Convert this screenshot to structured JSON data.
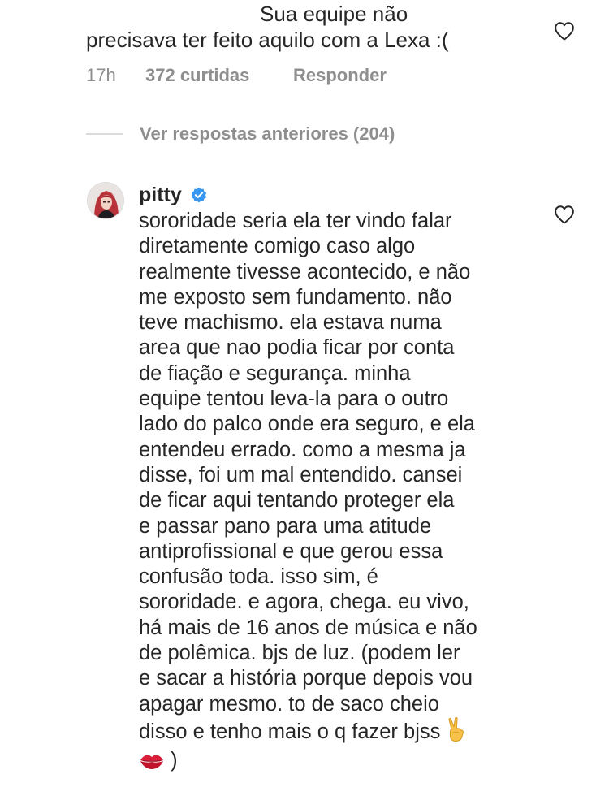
{
  "top_comment": {
    "text_lines": [
      "Sua equipe não",
      "precisava ter feito aquilo com a Lexa :("
    ],
    "time": "17h",
    "likes": "372 curtidas",
    "reply_label": "Responder"
  },
  "view_previous_replies": "Ver respostas anteriores (204)",
  "reply": {
    "username": "pitty",
    "verified": true,
    "text_lines": [
      "sororidade seria ela ter vindo falar",
      "diretamente comigo caso algo",
      "realmente tivesse acontecido, e não",
      "me exposto sem fundamento. não",
      "teve machismo. ela estava numa",
      "area que nao podia ficar por conta",
      "de fiação e segurança. minha",
      "equipe tentou leva-la para o outro",
      "lado do palco onde era seguro, e ela",
      "entendeu errado. como a mesma ja",
      "disse, foi um mal entendido. cansei",
      "de ficar aqui tentando proteger ela",
      "e passar pano para uma atitude",
      "antiprofissional e que gerou essa",
      "confusão toda. isso sim, é",
      "sororidade. e agora, chega. eu vivo,",
      "há mais de 16 anos de música e não",
      "de polêmica. bjs de luz. (podem ler",
      "e sacar a história porque depois vou",
      "apagar mesmo. to de saco cheio",
      "disso e tenho mais o q fazer bjss"
    ],
    "last_line_end": ")"
  },
  "icons": {
    "like": "heart-outline-icon",
    "verified": "verified-badge-icon",
    "victory": "victory-hand-emoji",
    "kiss": "kiss-mark-emoji"
  },
  "colors": {
    "text": "#262626",
    "meta": "#8e8e8e",
    "divider": "#dbdbdb",
    "verified": "#3897f0",
    "background": "#ffffff"
  }
}
